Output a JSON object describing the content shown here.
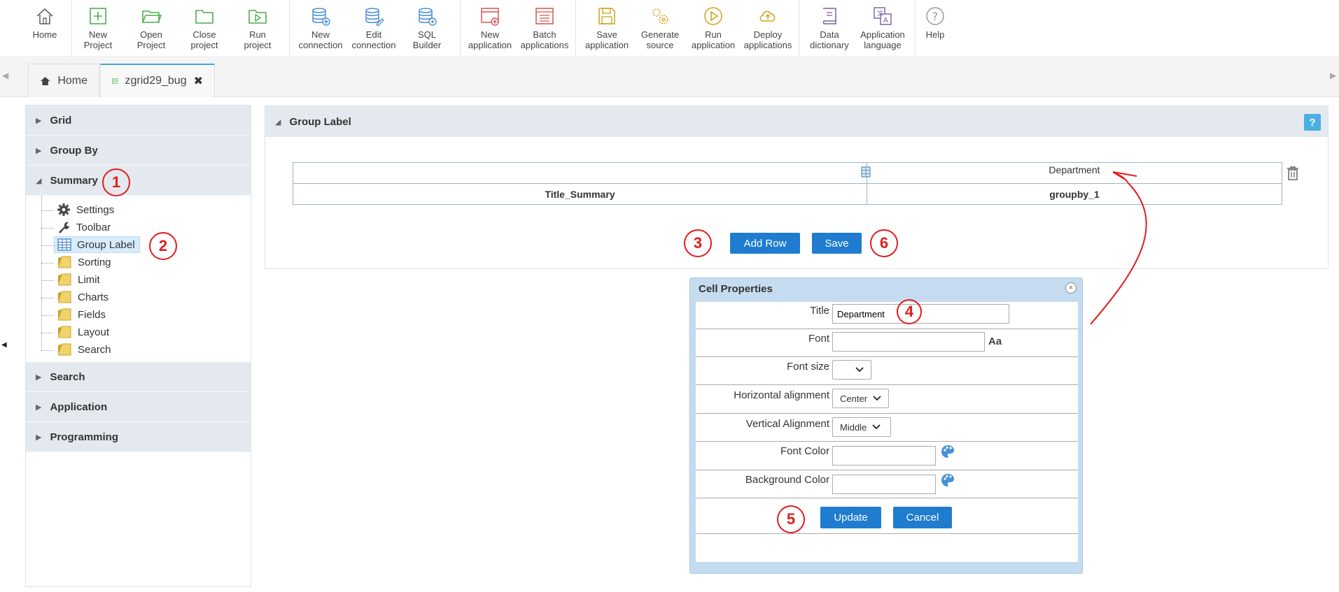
{
  "toolbar": {
    "items": [
      {
        "label": "Home",
        "icon": "home-icon"
      },
      {
        "label": "New Project",
        "icon": "new-project-icon"
      },
      {
        "label": "Open Project",
        "icon": "open-project-icon"
      },
      {
        "label": "Close project",
        "icon": "close-project-icon"
      },
      {
        "label": "Run project",
        "icon": "run-project-icon"
      },
      {
        "label": "New connection",
        "icon": "new-connection-icon"
      },
      {
        "label": "Edit connection",
        "icon": "edit-connection-icon"
      },
      {
        "label": "SQL Builder",
        "icon": "sql-builder-icon"
      },
      {
        "label": "New application",
        "icon": "new-application-icon"
      },
      {
        "label": "Batch applications",
        "icon": "batch-applications-icon"
      },
      {
        "label": "Save application",
        "icon": "save-application-icon"
      },
      {
        "label": "Generate source",
        "icon": "generate-source-icon"
      },
      {
        "label": "Run application",
        "icon": "run-application-icon"
      },
      {
        "label": "Deploy applications",
        "icon": "deploy-applications-icon"
      },
      {
        "label": "Data dictionary",
        "icon": "data-dictionary-icon"
      },
      {
        "label": "Application language",
        "icon": "application-language-icon"
      },
      {
        "label": "Help",
        "icon": "help-icon"
      }
    ]
  },
  "tabs": [
    {
      "label": "Home",
      "icon": "home-icon"
    },
    {
      "label": "zgrid29_bug",
      "icon": "grid-icon",
      "close": "✖"
    }
  ],
  "sidebar": {
    "sections": [
      {
        "label": "Grid"
      },
      {
        "label": "Group By"
      },
      {
        "label": "Summary",
        "expanded": true
      },
      {
        "label": "Search"
      },
      {
        "label": "Application"
      },
      {
        "label": "Programming"
      }
    ],
    "summary_items": [
      {
        "label": "Settings",
        "icon": "gear-icon"
      },
      {
        "label": "Toolbar",
        "icon": "wrench-icon"
      },
      {
        "label": "Group Label",
        "icon": "table-icon",
        "selected": true
      },
      {
        "label": "Sorting",
        "icon": "folder-icon"
      },
      {
        "label": "Limit",
        "icon": "folder-icon"
      },
      {
        "label": "Charts",
        "icon": "folder-icon"
      },
      {
        "label": "Fields",
        "icon": "folder-icon"
      },
      {
        "label": "Layout",
        "icon": "folder-icon"
      },
      {
        "label": "Search",
        "icon": "folder-icon"
      }
    ]
  },
  "panel": {
    "title": "Group Label",
    "help": "?",
    "grid": {
      "row1": [
        "",
        "Department"
      ],
      "row2": [
        "Title_Summary",
        "groupby_1"
      ]
    },
    "add_row_label": "Add Row",
    "save_label": "Save"
  },
  "annotations": [
    "1",
    "2",
    "3",
    "4",
    "5",
    "6"
  ],
  "dialog": {
    "title": "Cell Properties",
    "close": "×",
    "fields": {
      "title_label": "Title",
      "title_value": "Department",
      "font_label": "Font",
      "font_value": "",
      "font_icon": "Aa",
      "font_size_label": "Font size",
      "font_size_value": "",
      "h_align_label": "Horizontal alignment",
      "h_align_value": "Center",
      "v_align_label": "Vertical Alignment",
      "v_align_value": "Middle",
      "font_color_label": "Font Color",
      "font_color_value": "",
      "bg_color_label": "Background Color",
      "bg_color_value": ""
    },
    "update_label": "Update",
    "cancel_label": "Cancel"
  },
  "colors": {
    "accent": "#1f7ccf",
    "annotation": "#e31c1c",
    "header_bg": "#e4e9ef"
  }
}
